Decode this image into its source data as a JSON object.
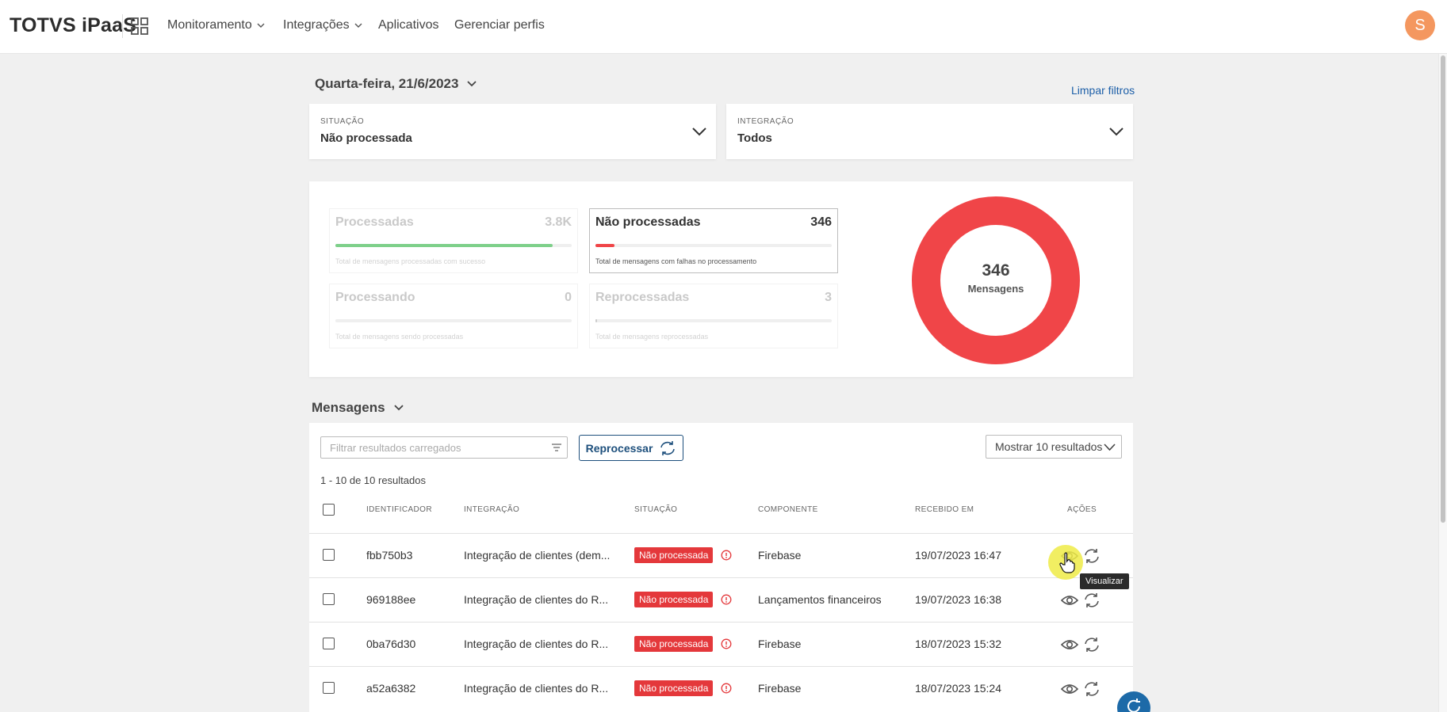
{
  "header": {
    "brand": "TOTVS iPaaS",
    "nav": [
      {
        "label": "Monitoramento",
        "has_dropdown": true
      },
      {
        "label": "Integrações",
        "has_dropdown": true
      },
      {
        "label": "Aplicativos",
        "has_dropdown": false
      },
      {
        "label": "Gerenciar perfis",
        "has_dropdown": false
      }
    ],
    "avatar_initial": "S",
    "avatar_color": "#f4975f"
  },
  "date": {
    "label": "Quarta-feira, 21/6/2023"
  },
  "clear_filters": "Limpar filtros",
  "filters": {
    "situacao": {
      "label": "SITUAÇÃO",
      "value": "Não processada"
    },
    "integracao": {
      "label": "INTEGRAÇÃO",
      "value": "Todos"
    }
  },
  "stats": {
    "cards": [
      {
        "name": "Processadas",
        "value": "3.8K",
        "description": "Total de mensagens processadas com sucesso",
        "progress": 0.92,
        "color": "#7ed08a",
        "active": false
      },
      {
        "name": "Não processadas",
        "value": "346",
        "description": "Total de mensagens com falhas no processamento",
        "progress": 0.08,
        "color": "#f04548",
        "active": true
      },
      {
        "name": "Processando",
        "value": "0",
        "description": "Total de mensagens sendo processadas",
        "progress": 0,
        "color": "#cccccc",
        "active": false
      },
      {
        "name": "Reprocessadas",
        "value": "3",
        "description": "Total de mensagens reprocessadas",
        "progress": 0.003,
        "color": "#cccccc",
        "active": false
      }
    ],
    "donut": {
      "value": "346",
      "label": "Mensagens",
      "color": "#f04548"
    }
  },
  "messages": {
    "title": "Mensagens",
    "search_placeholder": "Filtrar resultados carregados",
    "reprocess_label": "Reprocessar",
    "show_results": "Mostrar 10 resultados",
    "count": "1 - 10 de 10 resultados",
    "columns": [
      "IDENTIFICADOR",
      "INTEGRAÇÃO",
      "SITUAÇÃO",
      "COMPONENTE",
      "RECEBIDO EM",
      "AÇÕES"
    ],
    "rows": [
      {
        "id": "fbb750b3",
        "integration": "Integração de clientes (dem...",
        "status": "Não processada",
        "component": "Firebase",
        "received": "19/07/2023 16:47"
      },
      {
        "id": "969188ee",
        "integration": "Integração de clientes do R...",
        "status": "Não processada",
        "component": "Lançamentos financeiros",
        "received": "19/07/2023 16:38"
      },
      {
        "id": "0ba76d30",
        "integration": "Integração de clientes do R...",
        "status": "Não processada",
        "component": "Firebase",
        "received": "18/07/2023 15:32"
      },
      {
        "id": "a52a6382",
        "integration": "Integração de clientes do R...",
        "status": "Não processada",
        "component": "Firebase",
        "received": "18/07/2023 15:24"
      }
    ],
    "tooltip": "Visualizar"
  }
}
